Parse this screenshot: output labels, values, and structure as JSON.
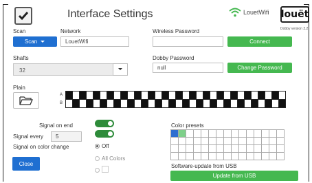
{
  "header": {
    "title": "Interface Settings",
    "wifi_name": "LouetWifi",
    "logo_text": "louët",
    "version": "Dobby version 2.2"
  },
  "network": {
    "scan_label": "Scan",
    "scan_button": "Scan",
    "network_label": "Network",
    "network_value": "LouetWifi",
    "wireless_password_label": "Wireless Password",
    "wireless_password_value": "",
    "connect_button": "Connect"
  },
  "shafts": {
    "label": "Shafts",
    "value": "32"
  },
  "dobby": {
    "password_label": "Dobby Password",
    "password_value": "null",
    "change_button": "Change Password"
  },
  "plain": {
    "label": "Plain",
    "row_a": "A",
    "row_b": "B",
    "columns": 32
  },
  "signals": {
    "signal_on_end": "Signal on end",
    "signal_every": "Signal every",
    "signal_every_value": "5",
    "signal_on_color_change": "Signal on color change",
    "options": [
      "Off",
      "All Colors"
    ],
    "selected": "Off"
  },
  "color_presets": {
    "label": "Color presets",
    "rows": 4,
    "cols": 15,
    "colors": [
      "#2f6fd0",
      "#7ed08a"
    ]
  },
  "update": {
    "label": "Software-update from USB",
    "button": "Update from USB"
  },
  "close_button": "Close",
  "colors": {
    "blue": "#1f6fd1",
    "green": "#45b850",
    "toggle_green": "#2e8b3a"
  }
}
